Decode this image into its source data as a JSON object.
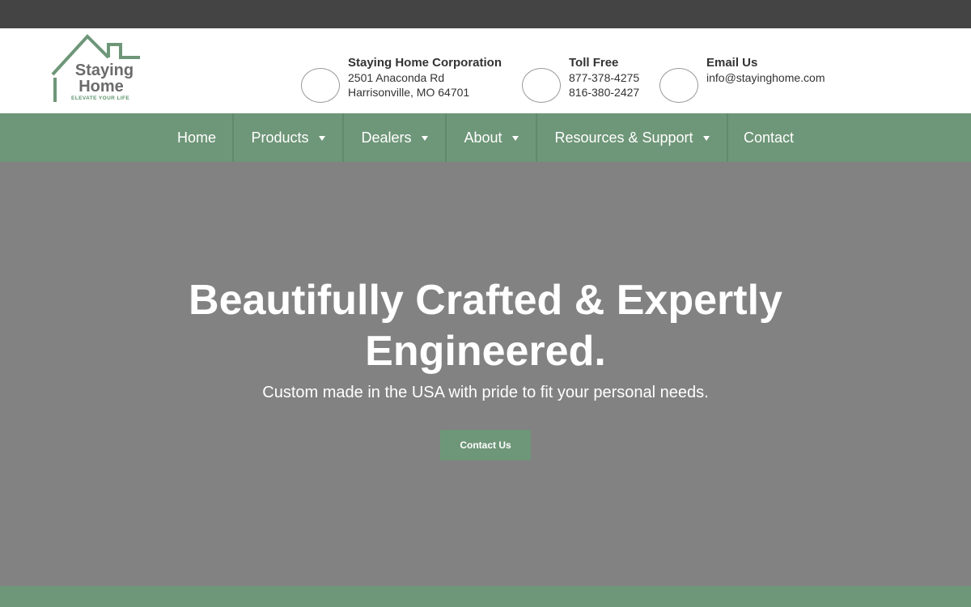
{
  "colors": {
    "topbar": "#444444",
    "brand_green": "#6e9678",
    "hero_bg": "#828282",
    "text_dark": "#333333"
  },
  "logo": {
    "line1": "Staying",
    "line2": "Home",
    "tagline": "ELEVATE YOUR LIFE",
    "icon": "house-roof-icon"
  },
  "contacts": [
    {
      "icon": "location-icon",
      "title": "Staying Home Corporation",
      "lines": [
        "2501 Anaconda Rd",
        "Harrisonville, MO 64701"
      ]
    },
    {
      "icon": "phone-icon",
      "title": "Toll Free",
      "lines": [
        "877-378-4275",
        "816-380-2427"
      ]
    },
    {
      "icon": "email-icon",
      "title": "Email Us",
      "lines": [
        "info@stayinghome.com"
      ]
    }
  ],
  "nav": [
    {
      "label": "Home",
      "has_dropdown": false
    },
    {
      "label": "Products",
      "has_dropdown": true
    },
    {
      "label": "Dealers",
      "has_dropdown": true
    },
    {
      "label": "About",
      "has_dropdown": true
    },
    {
      "label": "Resources & Support",
      "has_dropdown": true
    },
    {
      "label": "Contact",
      "has_dropdown": false
    }
  ],
  "hero": {
    "title_line1": "Beautifully Crafted & Expertly",
    "title_line2": "Engineered.",
    "subtitle": "Custom made in the USA with pride to fit your personal needs.",
    "button_label": "Contact Us"
  }
}
